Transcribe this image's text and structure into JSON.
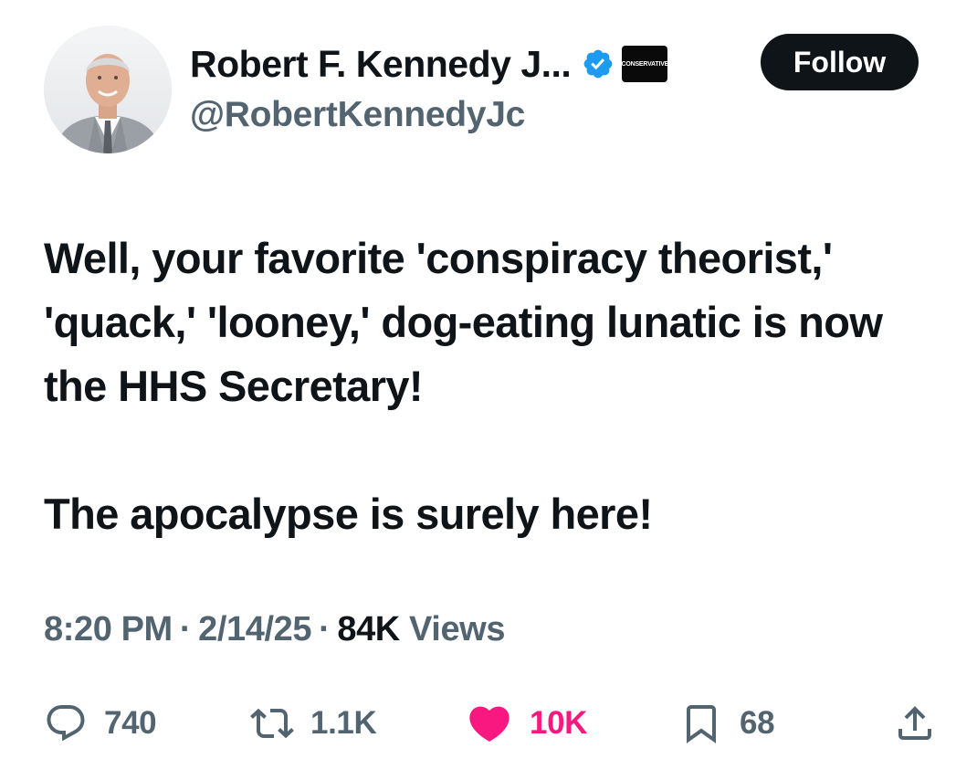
{
  "author": {
    "display_name": "Robert F. Kennedy J...",
    "handle": "@RobertKennedyJc",
    "affiliate_badge": "CONSERVATIVE",
    "verified_color": "#1d9bf0"
  },
  "follow_button": {
    "label": "Follow"
  },
  "tweet": {
    "paragraphs": [
      "Well, your favorite 'conspiracy theorist,' 'quack,' 'looney,' dog-eating lunatic is now the HHS Secretary!",
      "The apocalypse is surely here!"
    ]
  },
  "meta": {
    "time": "8:20 PM",
    "date": "2/14/25",
    "views_count": "84K",
    "views_label": "Views",
    "separator": "·"
  },
  "actions": {
    "replies": "740",
    "reposts": "1.1K",
    "likes": "10K",
    "bookmarks": "68"
  },
  "colors": {
    "text": "#0f1419",
    "secondary": "#536471",
    "like": "#f91880",
    "verified": "#1d9bf0"
  },
  "icons": [
    "reply-icon",
    "repost-icon",
    "heart-icon",
    "bookmark-icon",
    "share-icon",
    "verified-icon"
  ]
}
